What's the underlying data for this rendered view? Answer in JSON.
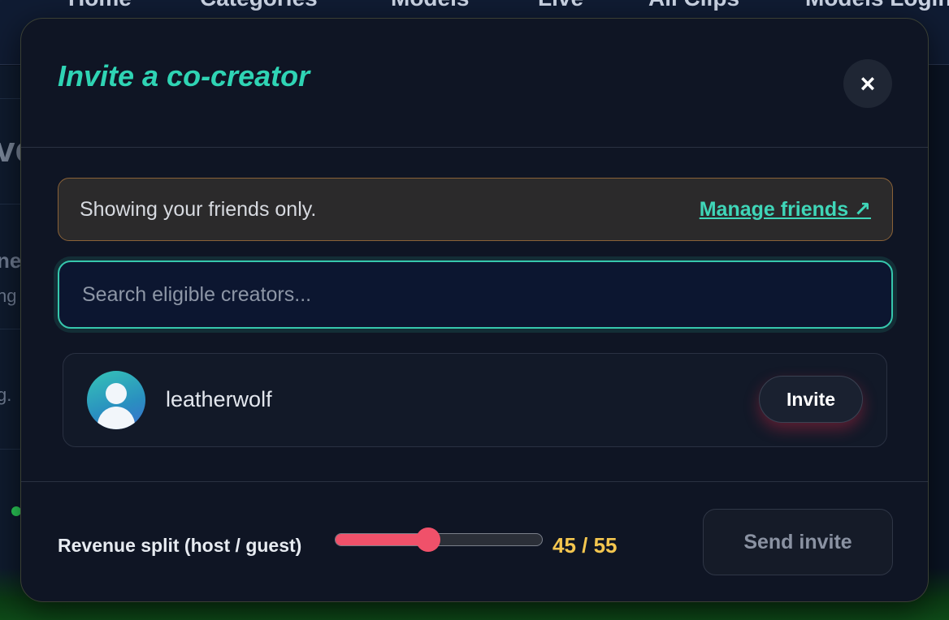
{
  "background_page": {
    "nav_items": [
      "Home",
      "Categories",
      "Models",
      "Live",
      "All Clips",
      "Models Login"
    ],
    "fragments": [
      "ve",
      "ne",
      "ng",
      "g."
    ]
  },
  "modal": {
    "title": "Invite a co-creator",
    "close_icon": "×",
    "notice": {
      "text": "Showing your friends only.",
      "link_label": "Manage friends ↗"
    },
    "search": {
      "placeholder": "Search eligible creators...",
      "value": ""
    },
    "creators": [
      {
        "name": "leatherwolf",
        "action_label": "Invite",
        "avatar_icon": "user-avatar-icon"
      }
    ],
    "revenue_split": {
      "label": "Revenue split (host / guest)",
      "host": 45,
      "guest": 55,
      "value_text": "45 / 55"
    },
    "send_button_label": "Send invite"
  },
  "colors": {
    "accent_teal": "#2fd4b4",
    "slider_red": "#f0516a",
    "split_value_yellow": "#f4c64f",
    "notice_border": "#8a6238"
  }
}
